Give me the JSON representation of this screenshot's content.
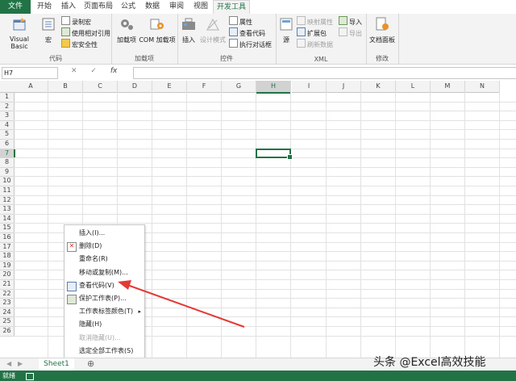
{
  "ribbon_tabs": [
    "文件",
    "开始",
    "插入",
    "页面布局",
    "公式",
    "数据",
    "审阅",
    "视图",
    "开发工具"
  ],
  "groups": {
    "code": {
      "label": "代码",
      "visual_basic": "Visual Basic",
      "macros": "宏",
      "record_macro": "录制宏",
      "relative_ref": "使用相对引用",
      "macro_security": "宏安全性"
    },
    "addins": {
      "label": "加载项",
      "addins": "加载项",
      "com_addins": "COM 加载项"
    },
    "controls": {
      "label": "控件",
      "insert": "插入",
      "design_mode": "设计模式",
      "properties": "属性",
      "view_code": "查看代码",
      "run_dialog": "执行对话框"
    },
    "xml": {
      "label": "XML",
      "source": "源",
      "map_props": "映射属性",
      "expansion": "扩展包",
      "refresh": "刷新数据",
      "import": "导入",
      "export": "导出"
    },
    "modify": {
      "label": "修改",
      "doc_panel": "文档面板"
    }
  },
  "name_box": "H7",
  "fx": "fx",
  "columns": [
    "A",
    "B",
    "C",
    "D",
    "E",
    "F",
    "G",
    "H",
    "I",
    "J",
    "K",
    "L",
    "M",
    "N"
  ],
  "selected_column": "H",
  "rows": [
    "1",
    "2",
    "3",
    "4",
    "5",
    "6",
    "7",
    "8",
    "9",
    "10",
    "11",
    "12",
    "13",
    "14",
    "15",
    "16",
    "17",
    "18",
    "19",
    "20",
    "21",
    "22",
    "23",
    "24",
    "25",
    "26"
  ],
  "selected_row": "7",
  "context_menu": [
    {
      "label": "插入(I)...",
      "enabled": true
    },
    {
      "label": "删除(D)",
      "enabled": true
    },
    {
      "label": "重命名(R)",
      "enabled": true
    },
    {
      "label": "移动或复制(M)...",
      "enabled": true
    },
    {
      "label": "查看代码(V)",
      "enabled": true
    },
    {
      "label": "保护工作表(P)...",
      "enabled": true
    },
    {
      "label": "工作表标签颜色(T)",
      "enabled": true
    },
    {
      "label": "隐藏(H)",
      "enabled": true
    },
    {
      "label": "取消隐藏(U)...",
      "enabled": false
    },
    {
      "label": "选定全部工作表(S)",
      "enabled": true
    }
  ],
  "sheet_tab": "Sheet1",
  "status_text": "就绪",
  "watermark": "头条 @Excel高效技能",
  "colors": {
    "accent": "#217346",
    "arrow": "#e53935"
  }
}
